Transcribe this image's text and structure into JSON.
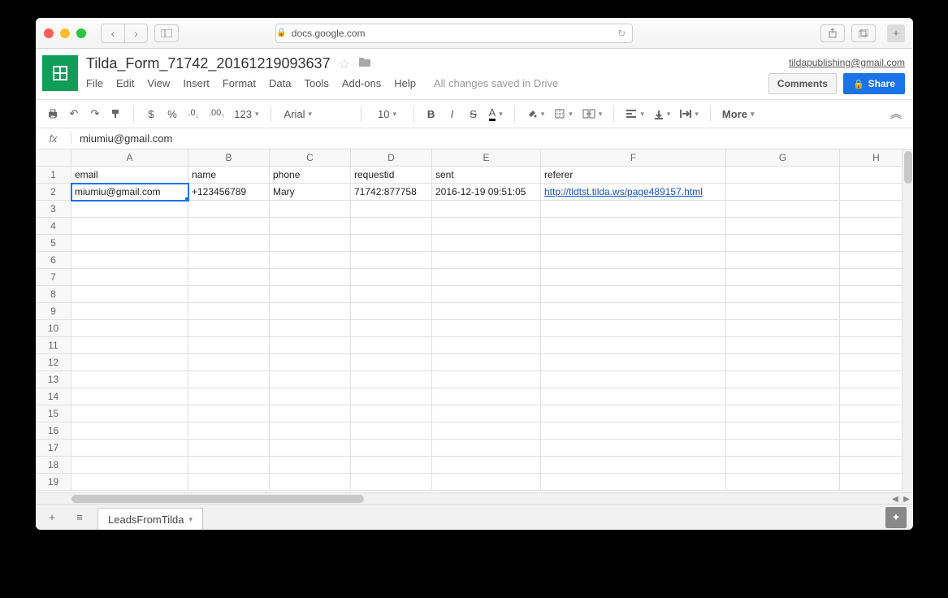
{
  "browser": {
    "domain": "docs.google.com"
  },
  "doc": {
    "title": "Tilda_Form_71742_20161219093637",
    "user_email": "tildapublishing@gmail.com",
    "saved_status": "All changes saved in Drive",
    "comments_label": "Comments",
    "share_label": "Share"
  },
  "menu": {
    "file": "File",
    "edit": "Edit",
    "view": "View",
    "insert": "Insert",
    "format": "Format",
    "data": "Data",
    "tools": "Tools",
    "addons": "Add-ons",
    "help": "Help"
  },
  "toolbar": {
    "dollar": "$",
    "percent": "%",
    "dec_dec": ".0",
    "dec_inc": ".00",
    "num_format": "123",
    "font": "Arial",
    "size": "10",
    "bold": "B",
    "italic": "I",
    "strike": "S",
    "more": "More"
  },
  "formula": {
    "value": "miumiu@gmail.com"
  },
  "columns": [
    "A",
    "B",
    "C",
    "D",
    "E",
    "F",
    "G",
    "H"
  ],
  "rows": [
    "1",
    "2",
    "3",
    "4",
    "5",
    "6",
    "7",
    "8",
    "9",
    "10",
    "11",
    "12",
    "13",
    "14",
    "15",
    "16",
    "17",
    "18",
    "19"
  ],
  "headers": {
    "A": "email",
    "B": "name",
    "C": "phone",
    "D": "requestid",
    "E": "sent",
    "F": "referer"
  },
  "data_row": {
    "A": "miumiu@gmail.com",
    "B": "+123456789",
    "C": "Mary",
    "D": "71742:877758",
    "E": "2016-12-19 09:51:05",
    "F": "http://tldtst.tilda.ws/page489157.html"
  },
  "sheet_tab": "LeadsFromTilda"
}
